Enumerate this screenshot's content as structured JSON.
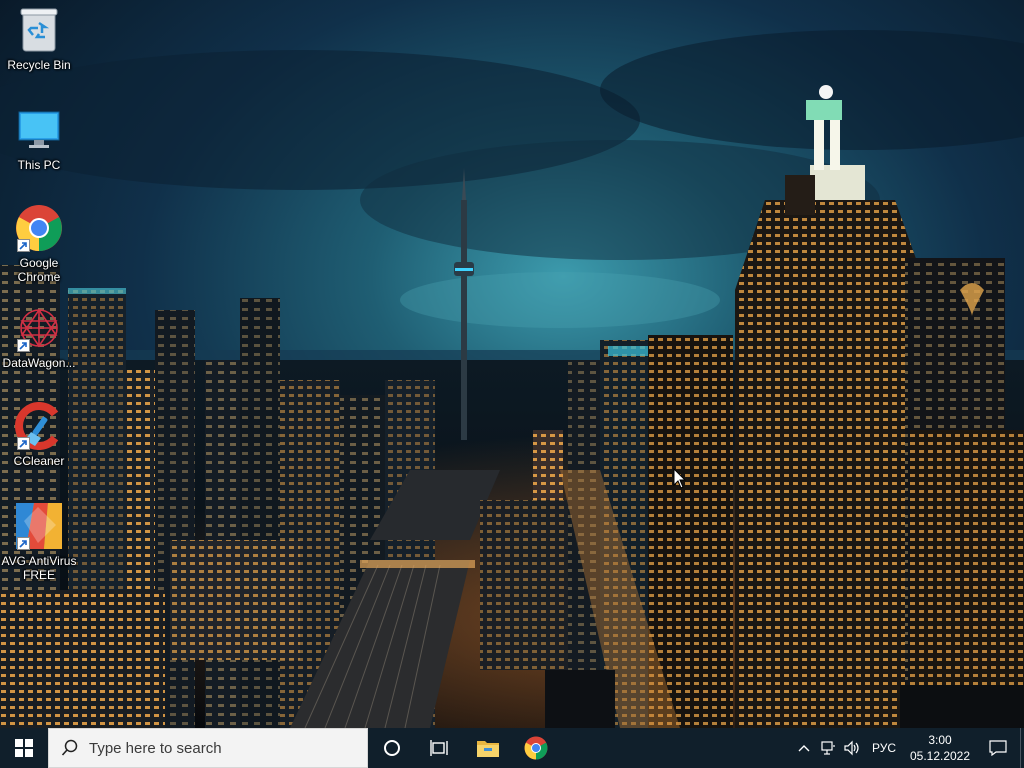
{
  "desktop": {
    "icons": [
      {
        "label": "Recycle Bin",
        "icon": "recycle-bin-icon",
        "shortcut": false
      },
      {
        "label": "This PC",
        "icon": "monitor-icon",
        "shortcut": false
      },
      {
        "label": "Google Chrome",
        "icon": "chrome-icon",
        "shortcut": true
      },
      {
        "label": "DataWagon...",
        "icon": "datawagon-icon",
        "shortcut": true
      },
      {
        "label": "CCleaner",
        "icon": "ccleaner-icon",
        "shortcut": true
      },
      {
        "label": "AVG AntiVirus FREE",
        "icon": "avg-icon",
        "shortcut": true
      }
    ]
  },
  "taskbar": {
    "search_placeholder": "Type here to search",
    "pinned": [
      "cortana-icon",
      "task-view-icon",
      "file-explorer-icon",
      "chrome-icon"
    ],
    "tray": {
      "icons": [
        "chevron-up-icon",
        "network-icon",
        "volume-icon"
      ],
      "language": "РУС",
      "time": "3:00",
      "date": "05.12.2022"
    }
  },
  "colors": {
    "taskbar_bg": "#101f2b",
    "search_bg": "#f3f3f3",
    "sky_teal": "#2f8a98",
    "city_lights": "#f2a53a"
  }
}
